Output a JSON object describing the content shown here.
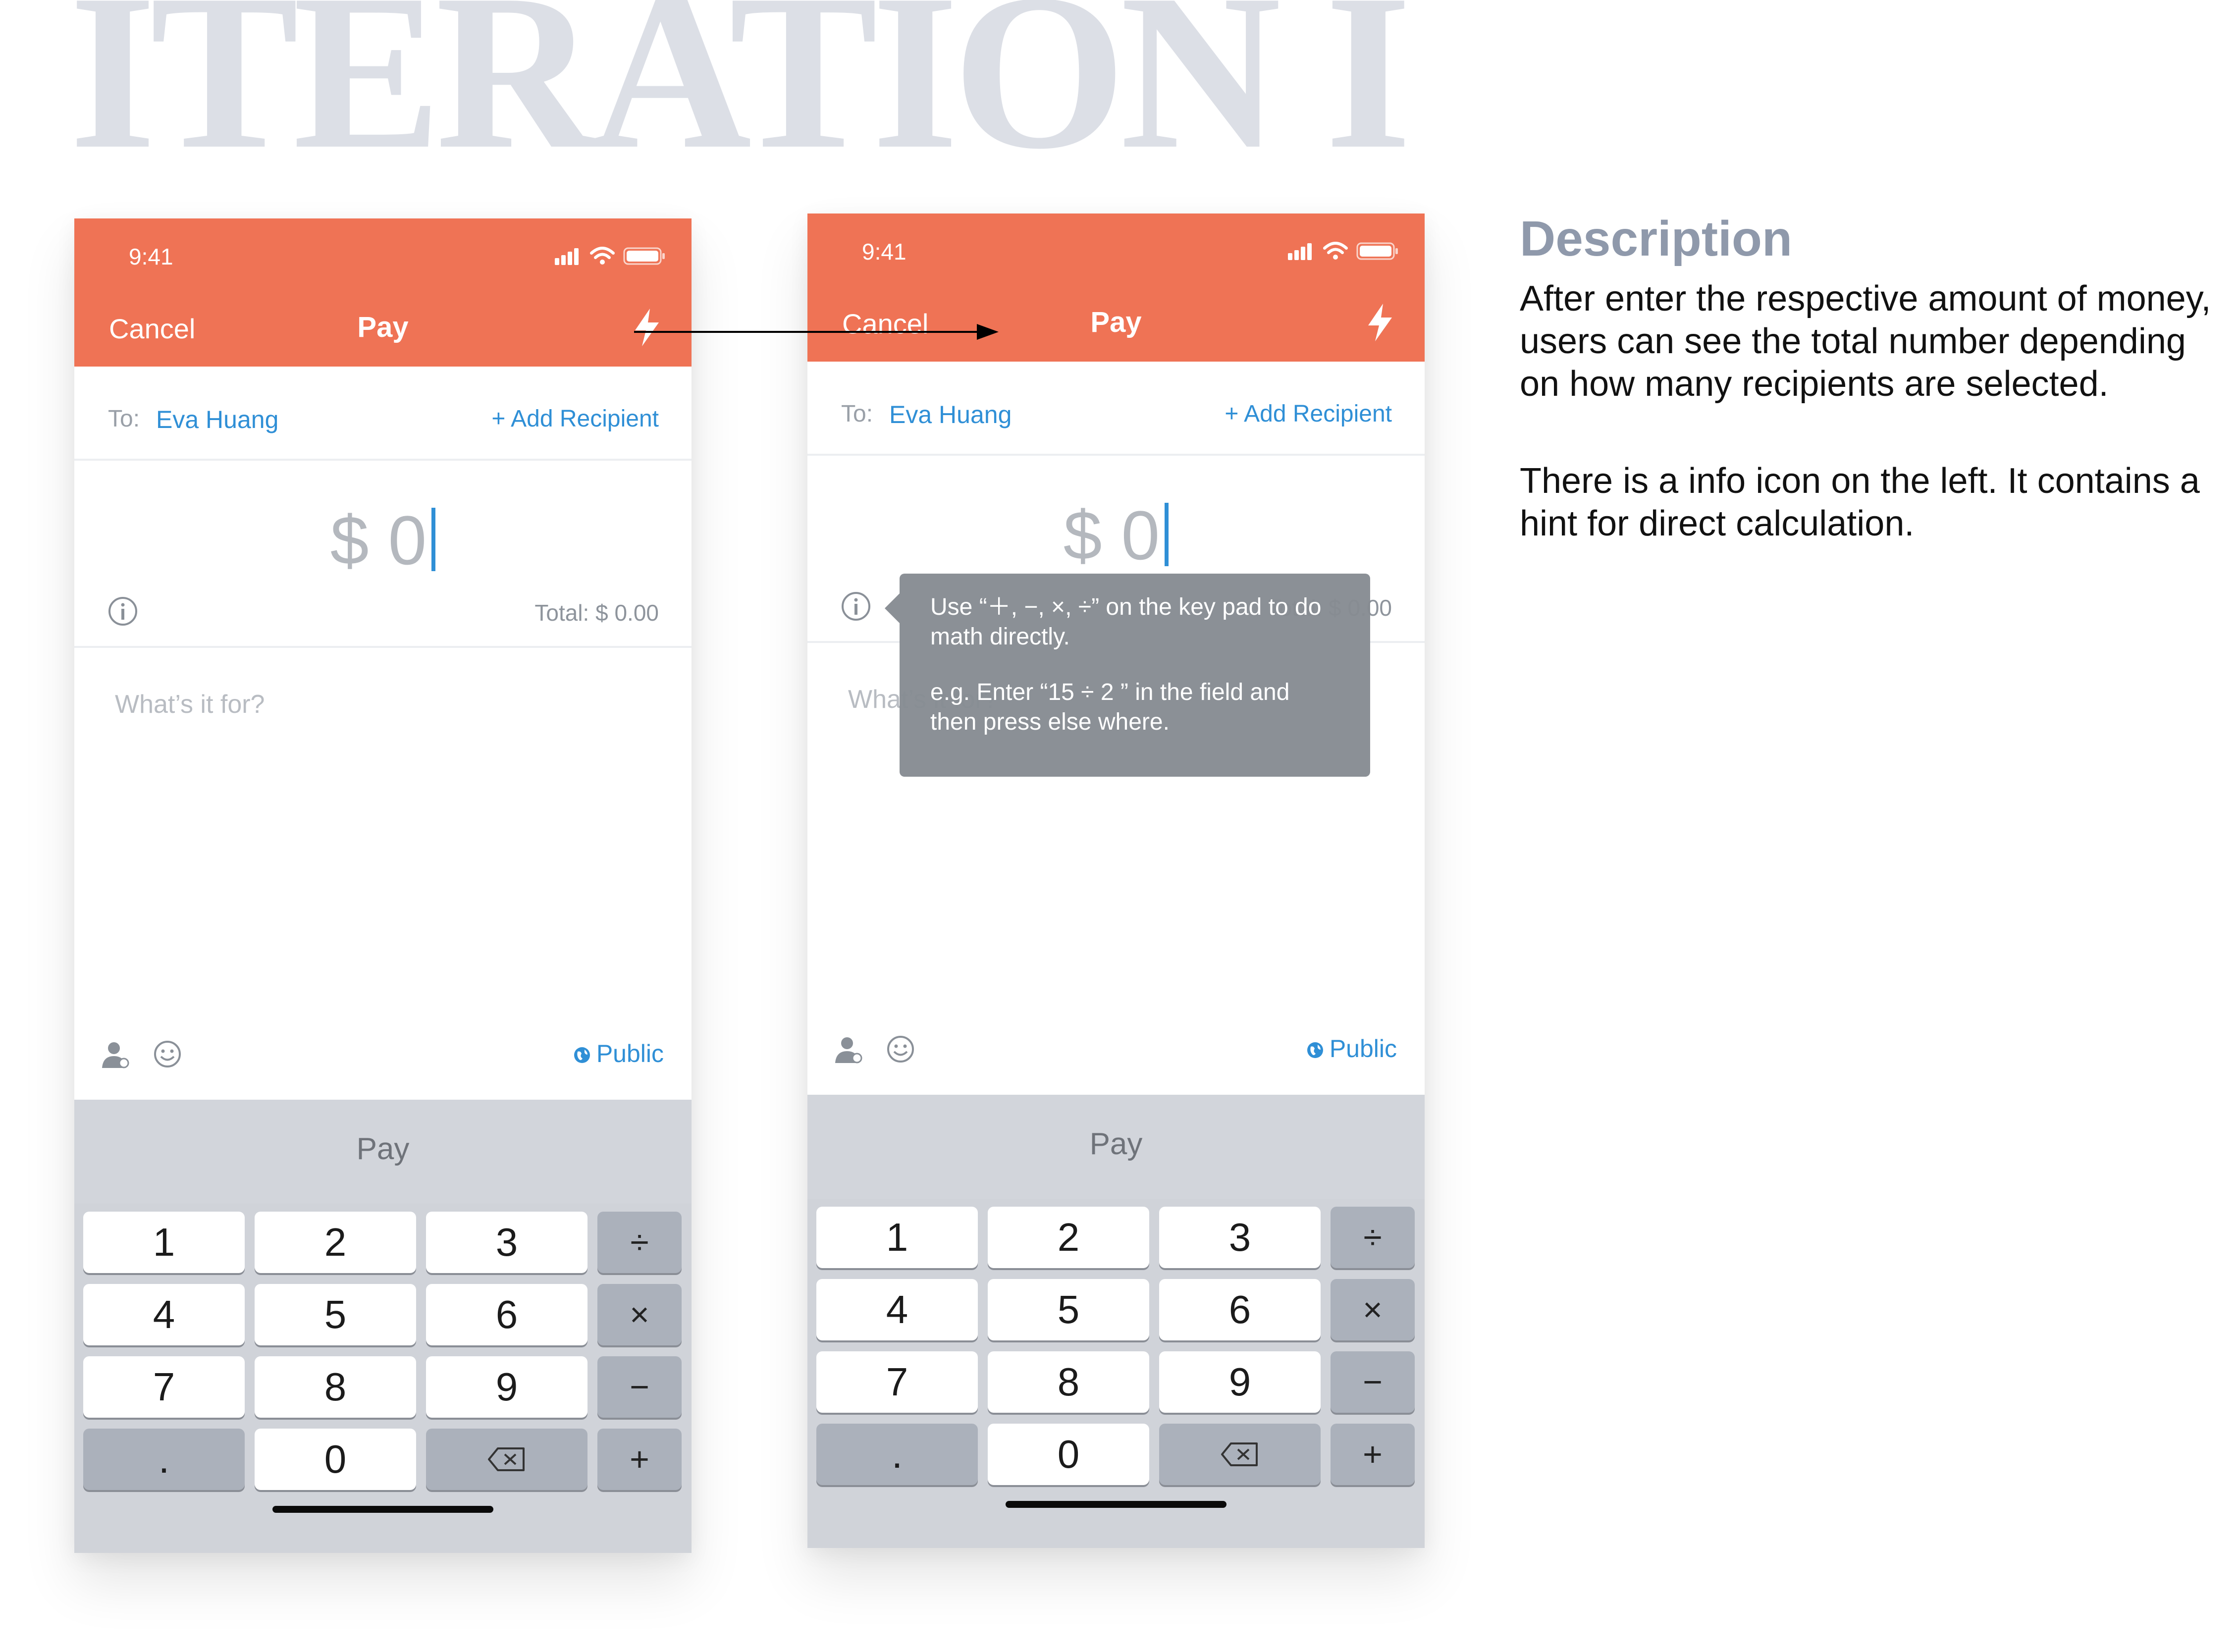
{
  "headline": "ITERATION I",
  "description": {
    "title": "Description",
    "paragraph1": "After enter the respective amount of money, users can see the total number depending on how many recipients are selected.",
    "paragraph2": "There is a info icon on the left. It contains a hint for direct calculation."
  },
  "phone": {
    "status_time": "9:41",
    "cancel": "Cancel",
    "title": "Pay",
    "to_label": "To:",
    "recipient": "Eva Huang",
    "add_recipient": "+ Add Recipient",
    "amount": "$ 0",
    "total": "Total: $ 0.00",
    "note_placeholder": "What’s it for?",
    "visibility": "Public",
    "keyboard_bar": "Pay",
    "keys": {
      "k1": "1",
      "k2": "2",
      "k3": "3",
      "div": "÷",
      "k4": "4",
      "k5": "5",
      "k6": "6",
      "mul": "×",
      "k7": "7",
      "k8": "8",
      "k9": "9",
      "minus": "−",
      "dot": ".",
      "k0": "0",
      "plus": "+"
    }
  },
  "tooltip": {
    "line1": "Use “＋, −, ×, ÷” on the key pad to do math directly.",
    "line2": "e.g. Enter “15 ÷ 2 ” in the field and then press else where."
  },
  "colors": {
    "header": "#ef7355",
    "link": "#2f8fd6",
    "tooltip": "#868b92",
    "headline": "#dcdfe6"
  }
}
